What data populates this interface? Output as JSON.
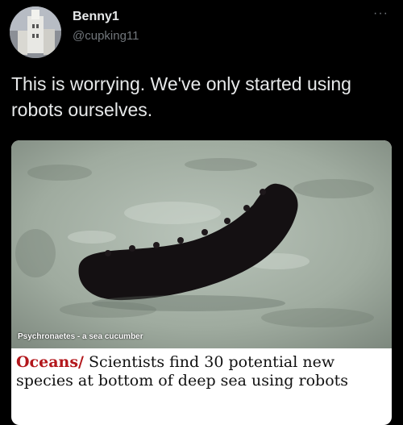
{
  "user": {
    "display_name": "Benny1",
    "handle": "@cupking11"
  },
  "menu": {
    "more_icon": "more-options-icon",
    "more_label": "···"
  },
  "tweet": {
    "text": "This is worrying. We've only started using robots ourselves."
  },
  "article": {
    "image_caption": "Psychronaetes - a sea cucumber",
    "section": "Oceans",
    "separator": "/",
    "headline": "Scientists find 30 potential new species at bottom of deep sea using robots"
  },
  "colors": {
    "background": "#000000",
    "text": "#e7e9ea",
    "muted": "#71767b",
    "section_red": "#b3171c"
  }
}
